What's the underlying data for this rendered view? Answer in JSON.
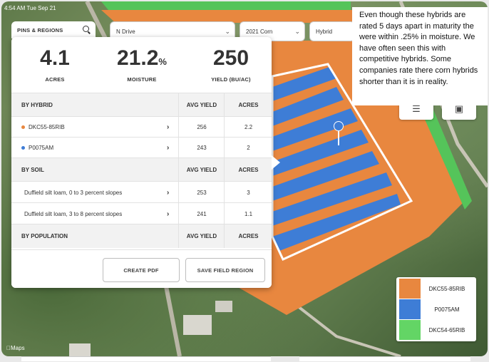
{
  "status": {
    "time": "4:54 AM  Tue Sep 21"
  },
  "pins_regions": {
    "label": "PINS & REGIONS"
  },
  "filters": {
    "drive": "N Drive",
    "season": "2021 Corn",
    "layer": "Hybrid"
  },
  "stats": [
    {
      "value": "4.1",
      "unit": "",
      "label": "ACRES"
    },
    {
      "value": "21.2",
      "unit": "%",
      "label": "MOISTURE"
    },
    {
      "value": "250",
      "unit": "",
      "label": "YIELD (BU/AC)"
    }
  ],
  "by_hybrid": {
    "header": "BY HYBRID",
    "col_yield": "AVG YIELD",
    "col_acres": "ACRES",
    "rows": [
      {
        "name": "DKC55-85RIB",
        "yield": "256",
        "acres": "2.2",
        "color": "#e8873f"
      },
      {
        "name": "P0075AM",
        "yield": "243",
        "acres": "2",
        "color": "#3e7dd6"
      }
    ]
  },
  "by_soil": {
    "header": "BY SOIL",
    "col_yield": "AVG YIELD",
    "col_acres": "ACRES",
    "rows": [
      {
        "name": "Duffield silt loam, 0 to 3 percent slopes",
        "yield": "253",
        "acres": "3"
      },
      {
        "name": "Duffield silt loam, 3 to 8 percent slopes",
        "yield": "241",
        "acres": "1.1"
      }
    ]
  },
  "by_population": {
    "header": "BY POPULATION",
    "col_yield": "AVG YIELD",
    "col_acres": "ACRES"
  },
  "buttons": {
    "create_pdf": "CREATE PDF",
    "save_region": "SAVE FIELD REGION"
  },
  "note": "Even though these hybrids are rated 5 days apart in maturity the were within .25% in moisture. We have often seen this with competitive hybrids. Some companies rate there corn  hybrids shorter than it is in reality.",
  "legend": [
    {
      "label": "DKC55-85RIB",
      "color": "#e8873f"
    },
    {
      "label": "P0075AM",
      "color": "#3e7dd6"
    },
    {
      "label": "DKC54-65RIB",
      "color": "#63d565"
    }
  ],
  "maps_label": "Maps"
}
